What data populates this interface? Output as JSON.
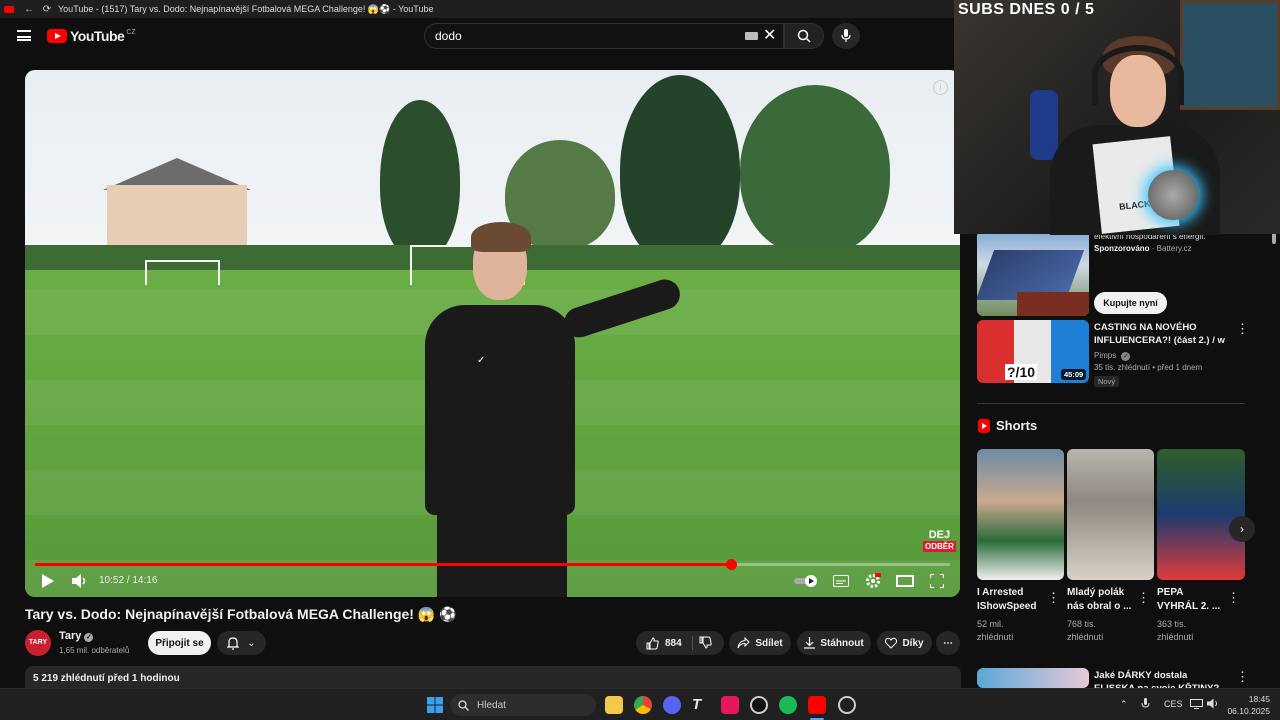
{
  "browser": {
    "title": "YouTube - (1517) Tary vs. Dodo: Nejnapínavější Fotbalová MEGA Challenge! 😱⚽ - YouTube"
  },
  "header": {
    "logo_text": "YouTube",
    "region": "CZ",
    "search_value": "dodo"
  },
  "player": {
    "time": "10:52 / 14:16",
    "progress": 0.761,
    "watermark_top": "DEJ",
    "watermark_bottom": "ODBĚR"
  },
  "video": {
    "title": "Tary vs. Dodo: Nejnapínavější Fotbalová MEGA Challenge! 😱 ⚽",
    "channel": "Tary",
    "channel_avatar_text": "TARY",
    "subscribers": "1,65 mil. odběratelů",
    "join_label": "Připojit se",
    "likes": "884",
    "share_label": "Sdílet",
    "download_label": "Stáhnout",
    "thanks_label": "Díky",
    "views_line": "5 219 zhlédnutí  před 1 hodinou"
  },
  "sidebar": {
    "ad": {
      "desc": "efektivní hospodaření s energií.",
      "sponsor_label": "Sponzorováno",
      "sponsor": "Battery.cz",
      "cta": "Kupujte nyní"
    },
    "video1": {
      "title": "CASTING NA NOVÉHO INFLUENCERA?! (část 2.) / w ...",
      "channel": "Pimps",
      "meta": "35 tis. zhlédnutí • před 1 dnem",
      "badge": "Nový",
      "duration": "45:09",
      "thumb_text": "?/10"
    },
    "shorts_label": "Shorts",
    "shorts": [
      {
        "title": "I Arrested IShowSpeed",
        "views": "52 mil. zhlédnutí"
      },
      {
        "title": "Mladý polák nás obral o ...",
        "views": "768 tis. zhlédnutí"
      },
      {
        "title": "PEPA VYHRÁL 2. ...",
        "views": "363 tis. zhlédnutí"
      }
    ],
    "video2": {
      "title": "Jaké DÁRKY dostala ELISSKA na svoje KŘTINY?"
    }
  },
  "webcam": {
    "overlay_text": "SUBS DNES  0 / 5",
    "shirt_text": "BLACK"
  },
  "taskbar": {
    "search_placeholder": "Hledat",
    "lang": "CES",
    "time": "18:45",
    "date": "06.10.2025"
  },
  "colors": {
    "accent": "#ff0000",
    "background": "#0f0f0f",
    "surface": "#272727"
  }
}
